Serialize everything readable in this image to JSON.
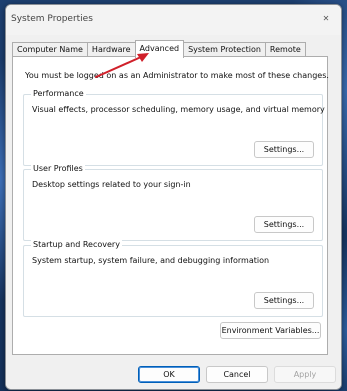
{
  "window": {
    "title": "System Properties",
    "close_glyph": "✕"
  },
  "tabs": [
    {
      "label": "Computer Name",
      "selected": false
    },
    {
      "label": "Hardware",
      "selected": false
    },
    {
      "label": "Advanced",
      "selected": true
    },
    {
      "label": "System Protection",
      "selected": false
    },
    {
      "label": "Remote",
      "selected": false
    }
  ],
  "advanced": {
    "admin_note": "You must be logged on as an Administrator to make most of these changes.",
    "performance": {
      "title": "Performance",
      "description": "Visual effects, processor scheduling, memory usage, and virtual memory",
      "button": "Settings..."
    },
    "user_profiles": {
      "title": "User Profiles",
      "description": "Desktop settings related to your sign-in",
      "button": "Settings..."
    },
    "startup_recovery": {
      "title": "Startup and Recovery",
      "description": "System startup, system failure, and debugging information",
      "button": "Settings..."
    },
    "env_button": "Environment Variables..."
  },
  "footer": {
    "ok": "OK",
    "cancel": "Cancel",
    "apply": "Apply"
  },
  "colors": {
    "annotation_arrow": "#d0202a",
    "accent_border": "#005fb8"
  }
}
